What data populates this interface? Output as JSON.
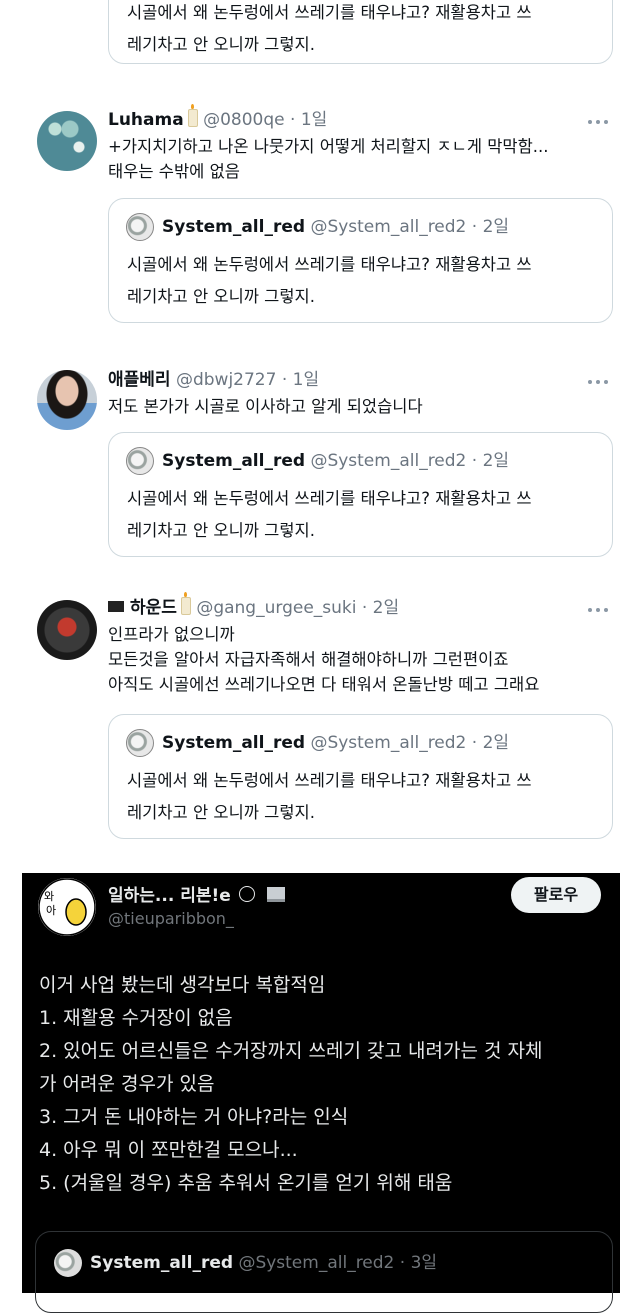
{
  "quoted_text": {
    "line1": "시골에서 왜 논두렁에서 쓰레기를 태우냐고? 재활용차고 쓰",
    "line2": "레기차고 안 오니까 그렇지."
  },
  "top_partial": {
    "line1": "시골에서 왜 논두렁에서 쓰레기를 태우냐고? 재활용차고 쓰",
    "line2": "레기차고 안 오니까 그렇지."
  },
  "quoted_author": {
    "name": "System_all_red",
    "meta": "@System_all_red2 · 2일"
  },
  "tweets": [
    {
      "name": "Luhama",
      "meta": "@0800qe · 1일",
      "lines": [
        "+가지치기하고 나온 나뭇가지 어떻게 처리할지 ㅈㄴ게 막막함...",
        "태우는 수밖에 없음"
      ]
    },
    {
      "name": "애플베리",
      "meta": "@dbwj2727 · 1일",
      "lines": [
        "저도 본가가 시골로 이사하고 알게 되었습니다"
      ]
    },
    {
      "name": "하운드",
      "meta": "@gang_urgee_suki · 2일",
      "lines": [
        "인프라가 없으니까",
        "모든것을 알아서 자급자족해서 해결해야하니까 그런편이죠",
        "아직도 시골에선 쓰레기나오면 다 태워서 온돌난방 떼고 그래요"
      ]
    }
  ],
  "dark_card": {
    "name": "일하는... 리본!e",
    "handle": "@tieuparibbon_",
    "follow_label": "팔로우",
    "lines": [
      "이거 사업 봤는데 생각보다 복합적임",
      "1. 재활용 수거장이 없음",
      "2. 있어도 어르신들은 수거장까지 쓰레기 갖고 내려가는 것 자체",
      "가 어려운 경우가 있음",
      "3. 그거 돈 내야하는 거 아냐?라는 인식",
      "4. 아우 뭐 이 쪼만한걸 모으나...",
      "5. (겨울일 경우) 추움 추워서 온기를 얻기 위해 태움"
    ],
    "quote_name": "System_all_red",
    "quote_meta": "@System_all_red2 · 3일"
  },
  "colors": {
    "text": "#0f1419",
    "muted": "#6b7580",
    "border": "#cfd9de",
    "dark_bg": "#000000"
  },
  "icons": [
    "more-icon",
    "candle-emoji",
    "flag-emoji",
    "face-emoji",
    "laptop-emoji"
  ]
}
